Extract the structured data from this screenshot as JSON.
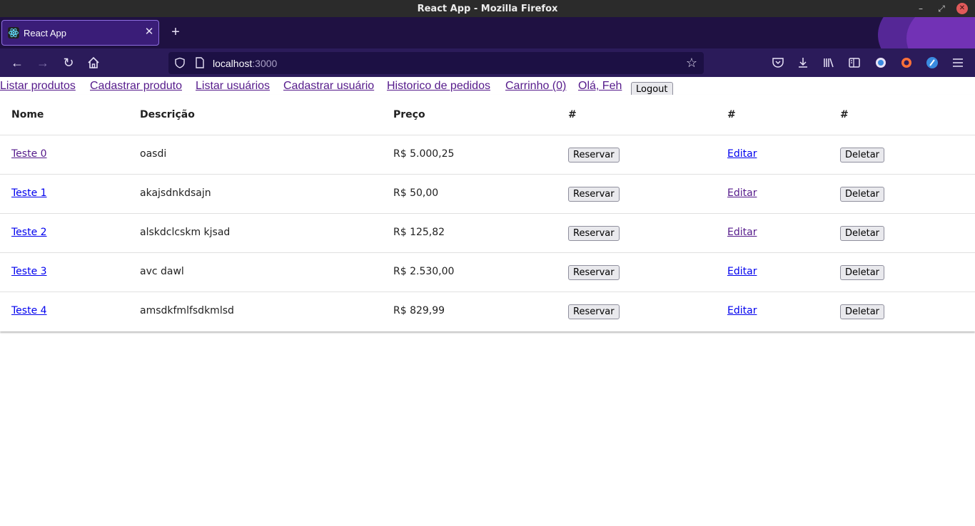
{
  "window": {
    "title": "React App - Mozilla Firefox",
    "minimize_glyph": "–",
    "maximize_glyph": "⤢",
    "close_glyph": "✕"
  },
  "tabs": [
    {
      "title": "React App",
      "favicon": "react-icon",
      "active": true
    }
  ],
  "browser": {
    "url_host": "localhost",
    "url_port": ":3000",
    "icons": [
      "back-icon",
      "forward-icon",
      "reload-icon",
      "home-icon",
      "shield-icon",
      "page-icon",
      "bookmark-star-icon",
      "pocket-icon",
      "downloads-icon",
      "library-icon",
      "sidebar-icon",
      "extension-icon",
      "firefox-account-icon",
      "extension-bitwarden-icon",
      "menu-icon"
    ],
    "accent_color": "#2b1b5a",
    "tab_color": "#1f1142"
  },
  "nav": {
    "links": [
      "Listar produtos",
      "Cadastrar produto",
      "Listar usuários",
      "Cadastrar usuário",
      "Historico de pedidos",
      "Carrinho (0)",
      "Olá, Feh"
    ],
    "logout_label": "Logout"
  },
  "table": {
    "headers": [
      "Nome",
      "Descrição",
      "Preço",
      "#",
      "#",
      "#"
    ],
    "rows": [
      {
        "name": "Teste 0",
        "description": "oasdi",
        "price": "R$ 5.000,25",
        "reserve": "Reservar",
        "edit": "Editar",
        "delete": "Deletar"
      },
      {
        "name": "Teste 1",
        "description": "akajsdnkdsajn",
        "price": "R$ 50,00",
        "reserve": "Reservar",
        "edit": "Editar",
        "delete": "Deletar"
      },
      {
        "name": "Teste 2",
        "description": "alskdclcskm kjsad",
        "price": "R$ 125,82",
        "reserve": "Reservar",
        "edit": "Editar",
        "delete": "Deletar"
      },
      {
        "name": "Teste 3",
        "description": "avc dawl",
        "price": "R$ 2.530,00",
        "reserve": "Reservar",
        "edit": "Editar",
        "delete": "Deletar"
      },
      {
        "name": "Teste 4",
        "description": "amsdkfmlfsdkmlsd",
        "price": "R$ 829,99",
        "reserve": "Reservar",
        "edit": "Editar",
        "delete": "Deletar"
      }
    ]
  }
}
